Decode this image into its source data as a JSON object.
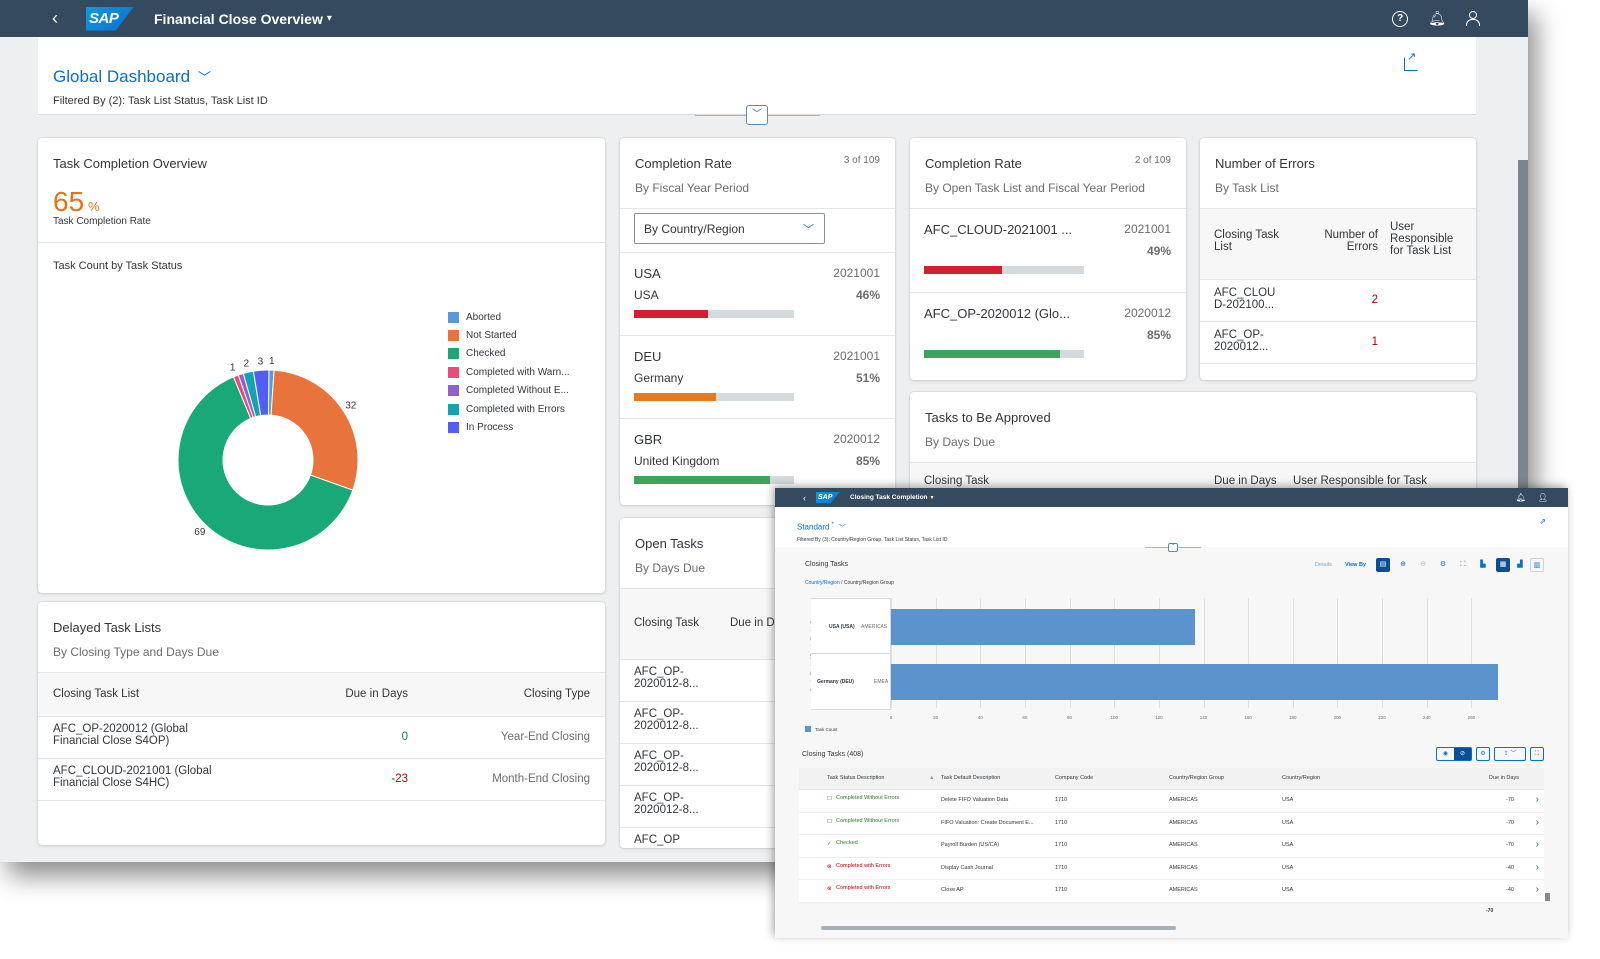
{
  "app": {
    "title": "Financial Close Overview",
    "back_label": "‹",
    "logo_text": "SAP",
    "help_icon": "?",
    "notifications_icon": "bell",
    "user_icon": "user"
  },
  "header": {
    "view_name": "Global Dashboard",
    "filter_text": "Filtered By (2): Task List Status, Task List ID"
  },
  "task_completion": {
    "title": "Task Completion Overview",
    "kpi_value": "65",
    "kpi_unit": "%",
    "kpi_label": "Task Completion Rate",
    "chart_title": "Task Count by Task Status"
  },
  "chart_data": {
    "type": "pie",
    "variant": "donut",
    "title": "Task Count by Task Status",
    "legend_position": "right",
    "categories": [
      "Aborted",
      "Not Started",
      "Checked",
      "Completed with Warn...",
      "Completed Without E...",
      "Completed with Errors",
      "In Process"
    ],
    "values": [
      1,
      32,
      69,
      1,
      1,
      2,
      3
    ],
    "data_labels": [
      "1",
      "32",
      "69",
      "1",
      "",
      "2",
      "3"
    ],
    "colors": [
      "#5899da",
      "#e8743b",
      "#19a979",
      "#ed4a7b",
      "#945ecf",
      "#13a4b4",
      "#525df4"
    ]
  },
  "completion_rate_1": {
    "title": "Completion Rate",
    "subtitle": "By Fiscal Year Period",
    "count": "3 of 109",
    "select_value": "By Country/Region",
    "items": [
      {
        "code": "USA",
        "name": "USA",
        "period": "2021001",
        "percent_label": "46%",
        "percent": 46,
        "color": "#d32030"
      },
      {
        "code": "DEU",
        "name": "Germany",
        "period": "2021001",
        "percent_label": "51%",
        "percent": 51,
        "color": "#e17b24"
      },
      {
        "code": "GBR",
        "name": "United Kingdom",
        "period": "2020012",
        "percent_label": "85%",
        "percent": 85,
        "color": "#3fa45b"
      }
    ]
  },
  "completion_rate_2": {
    "title": "Completion Rate",
    "subtitle": "By Open Task List and Fiscal Year Period",
    "count": "2 of 109",
    "items": [
      {
        "name": "AFC_CLOUD-2021001 ...",
        "period": "2021001",
        "percent_label": "49%",
        "percent": 49,
        "color": "#d32030"
      },
      {
        "name": "AFC_OP-2020012 (Glo...",
        "period": "2020012",
        "percent_label": "85%",
        "percent": 85,
        "color": "#3fa45b"
      }
    ]
  },
  "errors": {
    "title": "Number of Errors",
    "subtitle": "By Task List",
    "columns": [
      "Closing Task List",
      "Number of Errors",
      "User Responsible for Task List"
    ],
    "rows": [
      {
        "list": "AFC_CLOU D-202100...",
        "errors": "2",
        "user": ""
      },
      {
        "list": "AFC_OP- 2020012...",
        "errors": "1",
        "user": ""
      }
    ]
  },
  "approve": {
    "title": "Tasks to Be Approved",
    "subtitle": "By Days Due",
    "columns": [
      "Closing Task",
      "Due in Days",
      "User Responsible for Task"
    ]
  },
  "open_tasks": {
    "title": "Open Tasks",
    "subtitle": "By Days Due",
    "columns": [
      "Closing Task",
      "Due in D"
    ],
    "rows": [
      "AFC_OP- 2020012-8...",
      "AFC_OP- 2020012-8...",
      "AFC_OP- 2020012-8...",
      "AFC_OP- 2020012-8...",
      "AFC_OP"
    ]
  },
  "delayed": {
    "title": "Delayed Task Lists",
    "subtitle": "By Closing Type and Days Due",
    "columns": [
      "Closing Task List",
      "Due in Days",
      "Closing Type"
    ],
    "rows": [
      {
        "list": "AFC_OP-2020012 (Global Financial Close S4OP)",
        "due": "0",
        "type": "Year-End Closing",
        "due_color": "#107e3e"
      },
      {
        "list": "AFC_CLOUD-2021001 (Global Financial Close S4HC)",
        "due": "-23",
        "type": "Month-End Closing",
        "due_color": "#bb0000"
      }
    ]
  },
  "overlay": {
    "app_title": "Closing Task Completion",
    "view_name": "Standard",
    "view_dirty": "*",
    "filter_text": "Filtered By (3): Country/Region Group, Task List Status, Task List ID",
    "chart_title": "Closing Tasks",
    "breadcrumb_link": "Country/Region",
    "breadcrumb_rest": " / Country/Region Group",
    "details_label": "Details",
    "view_by_label": "View By",
    "y_axis_label": "Country/Region / Country/Region Group",
    "legend_label": "Task Count",
    "bar_chart": {
      "type": "bar",
      "orientation": "horizontal",
      "categories": [
        {
          "label": "USA (USA)",
          "group": "AMERICAS"
        },
        {
          "label": "Germany (DEU)",
          "group": "EMEA"
        }
      ],
      "values": [
        136,
        272
      ],
      "xlim": [
        0,
        280
      ],
      "ticks": [
        0,
        20,
        40,
        60,
        80,
        100,
        120,
        140,
        160,
        180,
        200,
        220,
        240,
        260
      ],
      "series_name": "Task Count"
    },
    "table_title": "Closing Tasks (408)",
    "columns": [
      "Task Status Description",
      "Task Default Description",
      "Company Code",
      "Country/Region Group",
      "Country/Region",
      "Due in Days"
    ],
    "rows": [
      {
        "status": "Completed Without Errors",
        "status_kind": "ok",
        "desc": "Delete FIFO Valuation Data",
        "company": "1710",
        "group": "AMERICAS",
        "country": "USA",
        "due": "-70"
      },
      {
        "status": "Completed Without Errors",
        "status_kind": "ok",
        "desc": "FIFO Valuation: Create Document E...",
        "company": "1710",
        "group": "AMERICAS",
        "country": "USA",
        "due": "-70"
      },
      {
        "status": "Checked",
        "status_kind": "checked",
        "desc": "Payroll Burden (US/CA)",
        "company": "1710",
        "group": "AMERICAS",
        "country": "USA",
        "due": "-70"
      },
      {
        "status": "Completed with Errors",
        "status_kind": "error",
        "desc": "Display Cash Journal",
        "company": "1710",
        "group": "AMERICAS",
        "country": "USA",
        "due": "-40"
      },
      {
        "status": "Completed with Errors",
        "status_kind": "error",
        "desc": "Close AP",
        "company": "1710",
        "group": "AMERICAS",
        "country": "USA",
        "due": "-40"
      }
    ],
    "total_due": "-70"
  }
}
